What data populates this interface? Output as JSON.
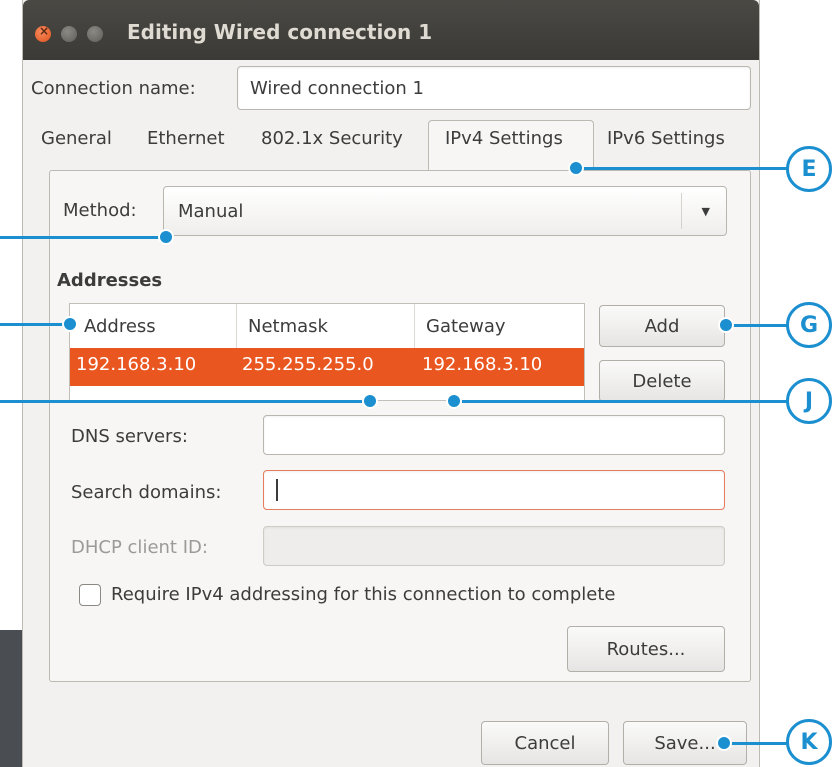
{
  "window": {
    "title": "Editing Wired connection 1"
  },
  "connection": {
    "name_label": "Connection name:",
    "name_value": "Wired connection 1"
  },
  "tabs": [
    {
      "label": "General"
    },
    {
      "label": "Ethernet"
    },
    {
      "label": "802.1x Security"
    },
    {
      "label": "IPv4 Settings",
      "active": true
    },
    {
      "label": "IPv6 Settings"
    }
  ],
  "method": {
    "label": "Method:",
    "value": "Manual"
  },
  "addresses": {
    "heading": "Addresses",
    "columns": [
      "Address",
      "Netmask",
      "Gateway"
    ],
    "rows": [
      [
        "192.168.3.10",
        "255.255.255.0",
        "192.168.3.10"
      ]
    ],
    "add_label": "Add",
    "delete_label": "Delete"
  },
  "dns": {
    "label": "DNS servers:",
    "value": ""
  },
  "search_domains": {
    "label": "Search domains:",
    "value": ""
  },
  "dhcp_client_id": {
    "label": "DHCP client ID:",
    "value": ""
  },
  "require_ipv4": {
    "label": "Require IPv4 addressing for this connection to complete",
    "checked": false
  },
  "routes_label": "Routes...",
  "footer": {
    "cancel_label": "Cancel",
    "save_label": "Save..."
  },
  "callouts": [
    "E",
    "G",
    "J",
    "K"
  ],
  "colors": {
    "accent": "#e9561f",
    "callout": "#1b8fcf",
    "titlebar": "#3c3b37"
  }
}
